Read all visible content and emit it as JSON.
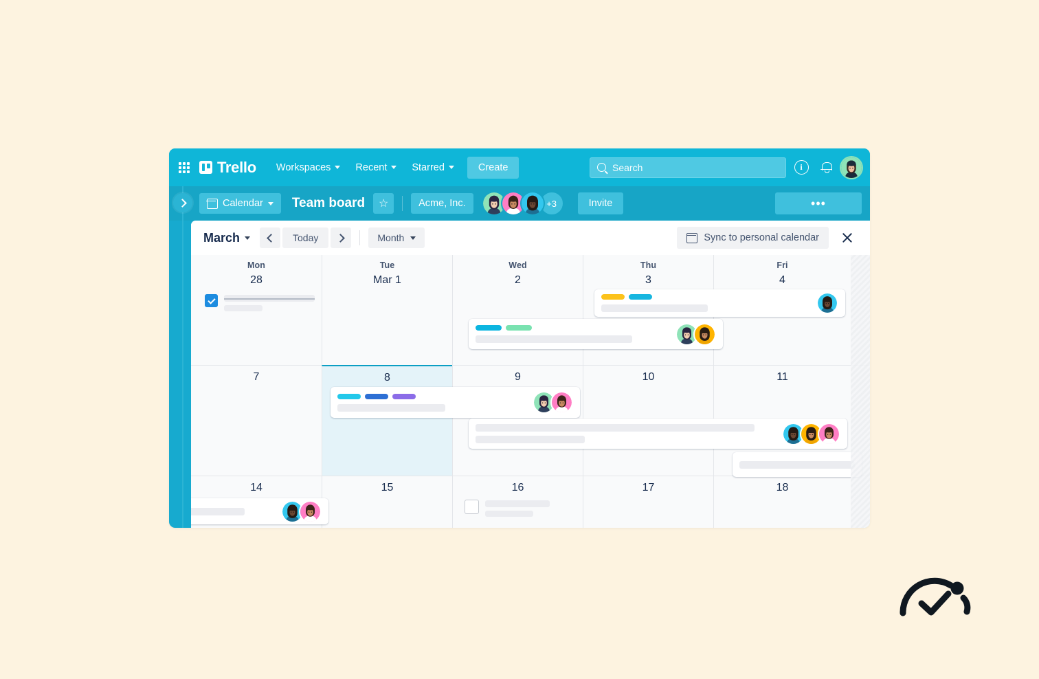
{
  "brand": {
    "name": "Trello",
    "app_bar_color": "#0fb6d8",
    "board_bar_color": "#17a5c6",
    "accent": "#0c9fc4"
  },
  "top_nav": {
    "apps_icon": "grid-apps-icon",
    "items": [
      {
        "label": "Workspaces",
        "has_caret": true
      },
      {
        "label": "Recent",
        "has_caret": true
      },
      {
        "label": "Starred",
        "has_caret": true
      }
    ],
    "create_label": "Create",
    "search": {
      "placeholder": "Search",
      "value": ""
    },
    "info_glyph": "i",
    "icons": [
      "info-icon",
      "notifications-bell-icon",
      "user-avatar"
    ]
  },
  "board_bar": {
    "sidebar_toggle": "expand-sidebar-chevron",
    "view_chip": "Calendar",
    "board_title": "Team board",
    "star_glyph": "☆",
    "workspace": "Acme, Inc.",
    "members_overflow": "+3",
    "invite_label": "Invite",
    "more_label": "•••"
  },
  "calendar": {
    "month": "March",
    "prev_label": "‹",
    "today_label": "Today",
    "next_label": "›",
    "view": "Month",
    "sync_label": "Sync to personal calendar",
    "close_label": "✕",
    "day_headers": [
      "Mon",
      "Tue",
      "Wed",
      "Thu",
      "Fri"
    ],
    "weeks": [
      {
        "days": [
          {
            "dow": "Mon",
            "num": "28",
            "today": false
          },
          {
            "dow": "Tue",
            "num": "Mar 1",
            "today": false
          },
          {
            "dow": "Wed",
            "num": "2",
            "today": false
          },
          {
            "dow": "Thu",
            "num": "3",
            "today": false
          },
          {
            "dow": "Fri",
            "num": "4",
            "today": false
          }
        ]
      },
      {
        "days": [
          {
            "dow": "",
            "num": "7",
            "today": false
          },
          {
            "dow": "",
            "num": "8",
            "today": true
          },
          {
            "dow": "",
            "num": "9",
            "today": false
          },
          {
            "dow": "",
            "num": "10",
            "today": false
          },
          {
            "dow": "",
            "num": "11",
            "today": false
          }
        ]
      },
      {
        "days": [
          {
            "dow": "",
            "num": "14",
            "today": false
          },
          {
            "dow": "",
            "num": "15",
            "today": false
          },
          {
            "dow": "",
            "num": "16",
            "today": false
          },
          {
            "dow": "",
            "num": "17",
            "today": false
          },
          {
            "dow": "",
            "num": "18",
            "today": false
          }
        ]
      }
    ],
    "events": [
      {
        "id": "evt-mar28",
        "kind": "checklist",
        "checked": true,
        "strikethrough": true,
        "labels": [],
        "avatars": []
      },
      {
        "id": "evt-mar2",
        "kind": "card",
        "labels": [
          "#0cb5e0",
          "#79e2b0"
        ],
        "avatars": [
          "mint",
          "amber"
        ]
      },
      {
        "id": "evt-mar3",
        "kind": "card",
        "labels": [
          "#fcc21b",
          "#17b6e0"
        ],
        "avatars": [
          "cyan"
        ]
      },
      {
        "id": "evt-mar8",
        "kind": "card",
        "labels": [
          "#22c8ea",
          "#2d6fd4",
          "#8b6ce8"
        ],
        "avatars": [
          "mint",
          "pink"
        ]
      },
      {
        "id": "evt-mar9",
        "kind": "card",
        "labels": [],
        "avatars": [
          "cyan",
          "amber",
          "pink"
        ]
      },
      {
        "id": "evt-mar11",
        "kind": "card",
        "labels": [],
        "avatars": []
      },
      {
        "id": "evt-mar14",
        "kind": "card",
        "labels": [],
        "avatars": [
          "cyan",
          "pink"
        ]
      },
      {
        "id": "evt-mar16",
        "kind": "checklist",
        "checked": false,
        "strikethrough": false,
        "labels": [],
        "avatars": []
      }
    ],
    "label_colors": {
      "yellow": "#fcc21b",
      "cyan": "#17b6e0",
      "blue": "#2d6fd4",
      "purple": "#8b6ce8",
      "green": "#79e2b0",
      "sky": "#22c8ea"
    }
  },
  "page": {
    "background": "#fdf3e0",
    "logo_name": "atlassian-check-logo"
  }
}
